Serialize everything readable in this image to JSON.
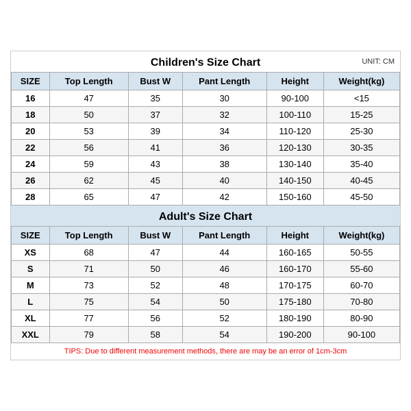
{
  "children": {
    "title": "Children's Size Chart",
    "unit": "UNIT: CM",
    "columns": [
      "SIZE",
      "Top Length",
      "Bust W",
      "Pant Length",
      "Height",
      "Weight(kg)"
    ],
    "rows": [
      [
        "16",
        "47",
        "35",
        "30",
        "90-100",
        "<15"
      ],
      [
        "18",
        "50",
        "37",
        "32",
        "100-110",
        "15-25"
      ],
      [
        "20",
        "53",
        "39",
        "34",
        "110-120",
        "25-30"
      ],
      [
        "22",
        "56",
        "41",
        "36",
        "120-130",
        "30-35"
      ],
      [
        "24",
        "59",
        "43",
        "38",
        "130-140",
        "35-40"
      ],
      [
        "26",
        "62",
        "45",
        "40",
        "140-150",
        "40-45"
      ],
      [
        "28",
        "65",
        "47",
        "42",
        "150-160",
        "45-50"
      ]
    ]
  },
  "adults": {
    "title": "Adult's Size Chart",
    "columns": [
      "SIZE",
      "Top Length",
      "Bust W",
      "Pant Length",
      "Height",
      "Weight(kg)"
    ],
    "rows": [
      [
        "XS",
        "68",
        "47",
        "44",
        "160-165",
        "50-55"
      ],
      [
        "S",
        "71",
        "50",
        "46",
        "160-170",
        "55-60"
      ],
      [
        "M",
        "73",
        "52",
        "48",
        "170-175",
        "60-70"
      ],
      [
        "L",
        "75",
        "54",
        "50",
        "175-180",
        "70-80"
      ],
      [
        "XL",
        "77",
        "56",
        "52",
        "180-190",
        "80-90"
      ],
      [
        "XXL",
        "79",
        "58",
        "54",
        "190-200",
        "90-100"
      ]
    ]
  },
  "tips": "TIPS: Due to different measurement methods, there are may be an error of 1cm-3cm"
}
